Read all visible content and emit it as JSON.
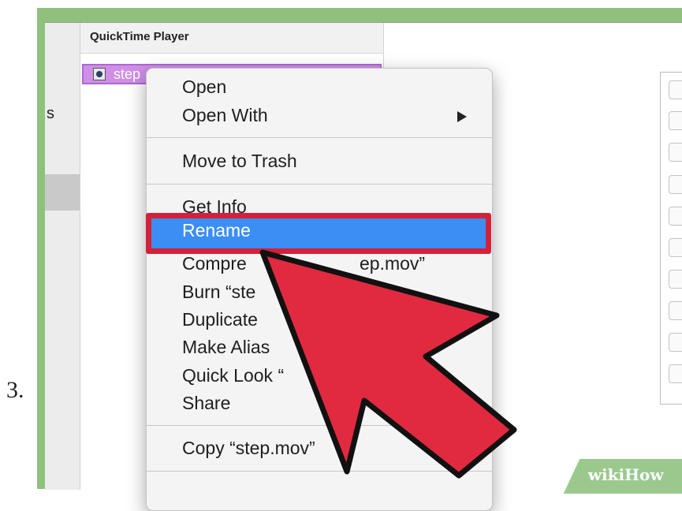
{
  "step_number": "3.",
  "finder": {
    "sidebar_label": "s",
    "column_header": "QuickTime Player",
    "selected_file": "step"
  },
  "context_menu": {
    "items": [
      {
        "label": "Open"
      },
      {
        "label": "Open With"
      },
      {
        "label": "Move to Trash"
      },
      {
        "label": "Get Info"
      },
      {
        "label": "Rename"
      },
      {
        "label": "Compre"
      },
      {
        "label": "Burn “ste"
      },
      {
        "label": "Duplicate"
      },
      {
        "label": "Make Alias"
      },
      {
        "label": "Quick Look “"
      },
      {
        "label": "Share"
      },
      {
        "label": "Copy “step.mov”"
      }
    ],
    "partial_text": "ep.mov”"
  },
  "watermark": {
    "part1": "wiki",
    "part2": "How"
  },
  "colors": {
    "highlight_border": "#d42139",
    "highlight_fill": "#3b8ef4",
    "cursor": "#e12a3f",
    "frame": "#8fc17d"
  }
}
